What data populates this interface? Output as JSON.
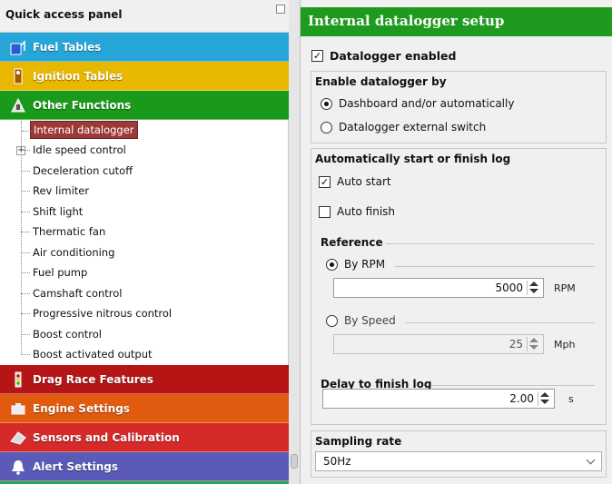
{
  "left_panel": {
    "title": "Quick access panel",
    "categories_top": [
      {
        "label": "Fuel Tables",
        "color": "#26a6d8",
        "icon": "fuel-icon"
      },
      {
        "label": "Ignition Tables",
        "color": "#e8b800",
        "icon": "ignition-icon"
      },
      {
        "label": "Other Functions",
        "color": "#1a9a1a",
        "icon": "other-functions-icon"
      }
    ],
    "tree_items": [
      "Internal datalogger",
      "Idle speed control",
      "Deceleration cutoff",
      "Rev limiter",
      "Shift light",
      "Thermatic fan",
      "Air conditioning",
      "Fuel pump",
      "Camshaft control",
      "Progressive nitrous control",
      "Boost control",
      "Boost activated output"
    ],
    "categories_bottom": [
      {
        "label": "Drag Race Features",
        "color": "#b51515",
        "icon": "drag-race-icon"
      },
      {
        "label": "Engine Settings",
        "color": "#e05a10",
        "icon": "engine-icon"
      },
      {
        "label": "Sensors and Calibration",
        "color": "#d42a2a",
        "icon": "sensors-icon"
      },
      {
        "label": "Alert Settings",
        "color": "#5a5ab8",
        "icon": "alert-icon"
      }
    ]
  },
  "right_panel": {
    "title": "Internal datalogger setup",
    "datalogger_enabled": {
      "label": "Datalogger enabled",
      "checked": true
    },
    "enable_by": {
      "heading": "Enable datalogger by",
      "options": [
        "Dashboard and/or automatically",
        "Datalogger external switch"
      ],
      "selected": 0
    },
    "auto_log": {
      "heading": "Automatically start or finish log",
      "auto_start": {
        "label": "Auto start",
        "checked": true
      },
      "auto_finish": {
        "label": "Auto finish",
        "checked": false
      },
      "reference": {
        "heading": "Reference",
        "by_rpm": {
          "label": "By RPM",
          "value": "5000",
          "unit": "RPM",
          "selected": true
        },
        "by_speed": {
          "label": "By Speed",
          "value": "25",
          "unit": "Mph",
          "selected": false
        }
      },
      "delay": {
        "heading": "Delay to finish log",
        "value": "2.00",
        "unit": "s"
      }
    },
    "sampling": {
      "heading": "Sampling rate",
      "value": "50Hz"
    }
  }
}
